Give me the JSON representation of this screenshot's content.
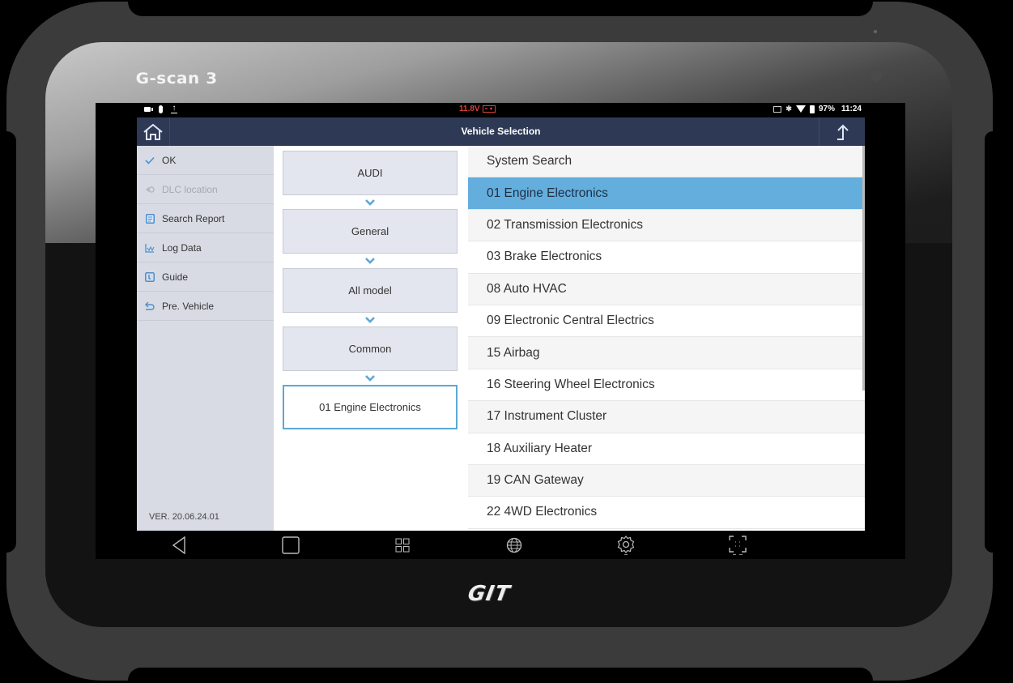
{
  "device": {
    "brand_logo": "G-scan 3",
    "maker_logo": "GIT"
  },
  "status_bar": {
    "left_icons": [
      "video-icon",
      "capsule-icon",
      "upload-icon"
    ],
    "voltage": "11.8V",
    "voltage_icon": "car-battery-icon",
    "right_icons": [
      "cast-icon",
      "bluetooth-icon",
      "wifi-icon",
      "battery-charging-icon"
    ],
    "battery": "97%",
    "time": "11:24",
    "colors": {
      "voltage": "#d9423b"
    }
  },
  "header": {
    "title": "Vehicle Selection",
    "home_icon": "home-icon",
    "up_icon": "up-arrow-icon",
    "background": "#2e3a55"
  },
  "sidebar": {
    "items": [
      {
        "label": "OK",
        "icon": "check-icon",
        "enabled": true
      },
      {
        "label": "DLC location",
        "icon": "location-icon",
        "enabled": false
      },
      {
        "label": "Search Report",
        "icon": "report-icon",
        "enabled": true
      },
      {
        "label": "Log Data",
        "icon": "chart-icon",
        "enabled": true
      },
      {
        "label": "Guide",
        "icon": "guide-icon",
        "enabled": true
      },
      {
        "label": "Pre. Vehicle",
        "icon": "back-icon",
        "enabled": true
      }
    ],
    "version": "VER. 20.06.24.01"
  },
  "breadcrumb": {
    "steps": [
      {
        "label": "AUDI"
      },
      {
        "label": "General"
      },
      {
        "label": "All model"
      },
      {
        "label": "Common"
      },
      {
        "label": "01 Engine Electronics",
        "active": true
      }
    ]
  },
  "system_list": {
    "items": [
      {
        "label": "System Search"
      },
      {
        "label": "01 Engine Electronics",
        "selected": true
      },
      {
        "label": "02 Transmission Electronics"
      },
      {
        "label": "03 Brake Electronics"
      },
      {
        "label": "08 Auto HVAC"
      },
      {
        "label": "09 Electronic Central Electrics"
      },
      {
        "label": "15 Airbag"
      },
      {
        "label": "16 Steering Wheel Electronics"
      },
      {
        "label": "17 Instrument Cluster"
      },
      {
        "label": "18 Auxiliary Heater"
      },
      {
        "label": "19 CAN Gateway"
      },
      {
        "label": "22 4WD Electronics"
      }
    ],
    "selected_color": "#63aedd"
  },
  "nav_bar": {
    "buttons": [
      "back-icon",
      "recents-icon",
      "apps-grid-icon",
      "globe-icon",
      "settings-icon",
      "screenshot-icon"
    ]
  }
}
